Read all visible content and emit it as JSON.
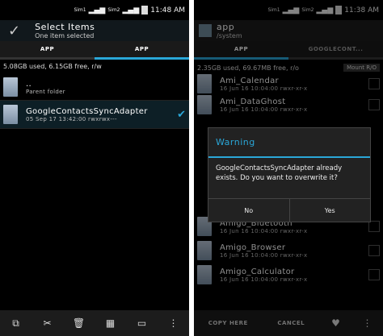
{
  "left": {
    "status": {
      "signal1": "Sim1",
      "signal2": "Sim2",
      "time": "11:48 AM"
    },
    "action_bar": {
      "title": "Select Items",
      "subtitle": "One item selected"
    },
    "tabs": [
      {
        "label": "APP"
      },
      {
        "label": "APP"
      }
    ],
    "storage_info": "5.08GB used, 6.15GB free, r/w",
    "items": [
      {
        "name": "..",
        "meta": "Parent folder"
      },
      {
        "name": "GoogleContactsSyncAdapter",
        "meta": "05 Sep 17 13:42:00  rwxrwx---"
      }
    ],
    "accent": "#2aa7d8"
  },
  "right": {
    "status": {
      "signal1": "Sim1",
      "signal2": "Sim2",
      "time": "11:38 AM"
    },
    "action_bar": {
      "title": "app",
      "subtitle": "/system"
    },
    "tabs": [
      {
        "label": "APP"
      },
      {
        "label": "GOOGLECONT..."
      }
    ],
    "storage_info": "2.35GB used, 69.67MB free, r/o",
    "mount_button": "Mount R/O",
    "items": [
      {
        "name": "Ami_Calendar",
        "meta": "16 Jun 16 10:04:00  rwxr-xr-x"
      },
      {
        "name": "Ami_DataGhost",
        "meta": "16 Jun 16 10:04:00  rwxr-xr-x"
      },
      {
        "name": "Amigo_Bluetooth",
        "meta": "16 Jun 16 10:04:00  rwxr-xr-x"
      },
      {
        "name": "Amigo_Browser",
        "meta": "16 Jun 16 10:04:00  rwxr-xr-x"
      },
      {
        "name": "Amigo_Calculator",
        "meta": "16 Jun 16 10:04:00  rwxr-xr-x"
      }
    ],
    "bottom": {
      "copy": "COPY HERE",
      "cancel": "CANCEL"
    },
    "dialog": {
      "title": "Warning",
      "message": "GoogleContactsSyncAdapter already exists. Do you want to overwrite it?",
      "no": "No",
      "yes": "Yes"
    }
  }
}
